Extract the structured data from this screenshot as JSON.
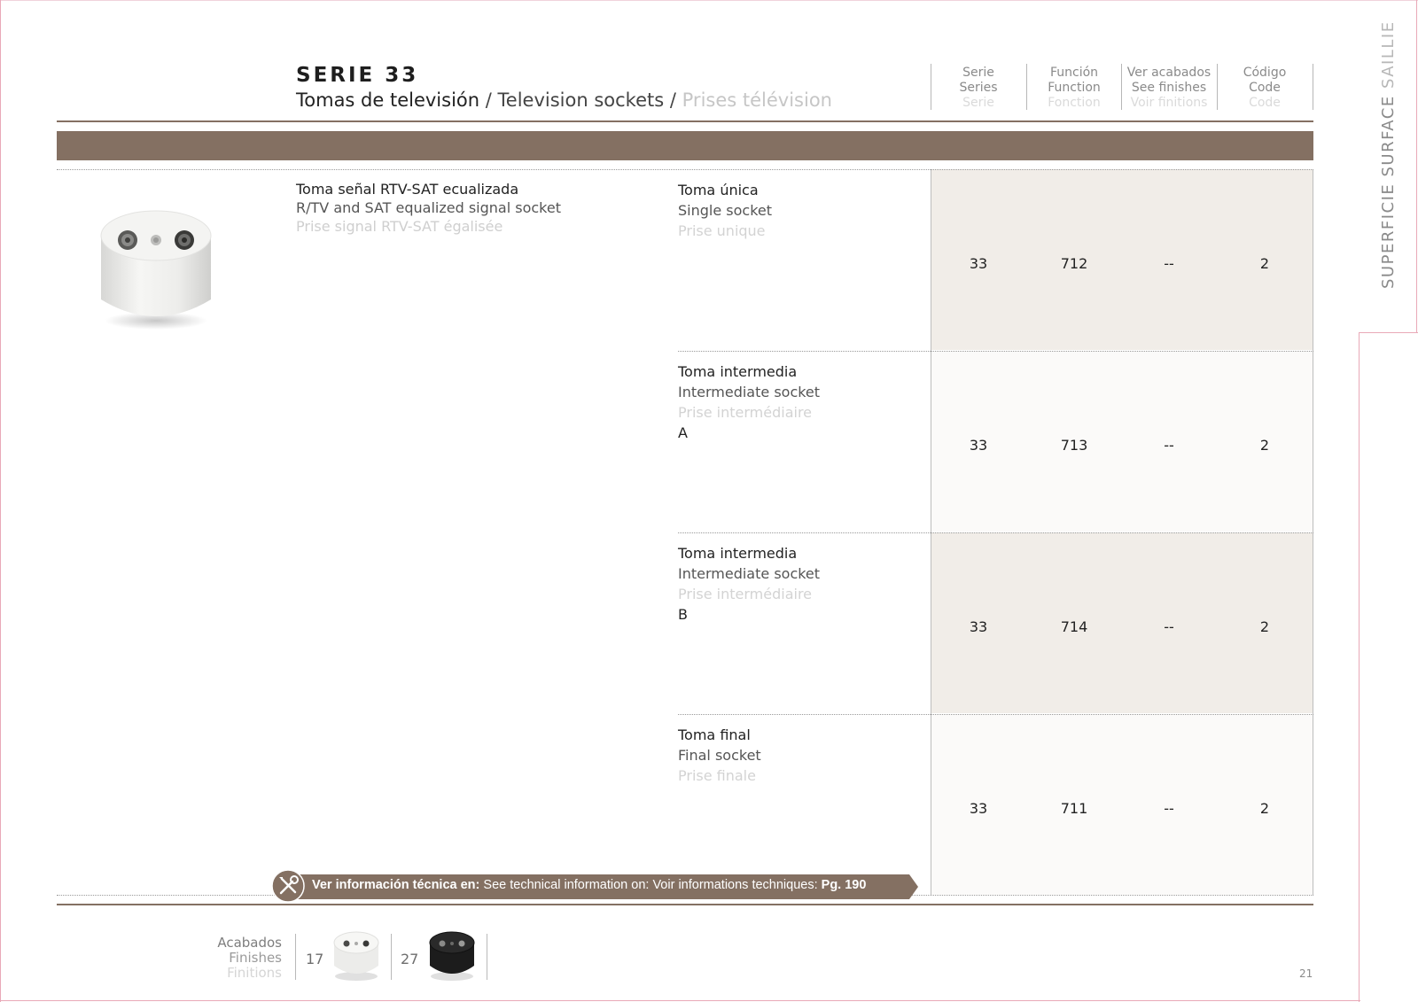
{
  "header": {
    "series_title": "SERIE 33",
    "subtitle_es": "Tomas de televisión",
    "separator": "/",
    "subtitle_en": "Television sockets",
    "subtitle_fr": "Prises télévision"
  },
  "columns": [
    {
      "es": "Serie",
      "en": "Series",
      "fr": "Serie"
    },
    {
      "es": "Función",
      "en": "Function",
      "fr": "Fonction"
    },
    {
      "es": "Ver acabados",
      "en": "See finishes",
      "fr": "Voir finitions"
    },
    {
      "es": "Código",
      "en": "Code",
      "fr": "Code"
    }
  ],
  "product": {
    "name_es": "Toma señal RTV-SAT ecualizada",
    "name_en": "R/TV and SAT equalized signal socket",
    "name_fr": "Prise signal RTV-SAT égalisée"
  },
  "rows": [
    {
      "es": "Toma única",
      "en": "Single socket",
      "fr": "Prise unique",
      "letter": "",
      "serie": "33",
      "funcion": "712",
      "acabados": "--",
      "codigo": "2"
    },
    {
      "es": "Toma intermedia",
      "en": "Intermediate socket",
      "fr": "Prise intermédiaire",
      "letter": "A",
      "serie": "33",
      "funcion": "713",
      "acabados": "--",
      "codigo": "2"
    },
    {
      "es": "Toma intermedia",
      "en": "Intermediate socket",
      "fr": "Prise intermédiaire",
      "letter": "B",
      "serie": "33",
      "funcion": "714",
      "acabados": "--",
      "codigo": "2"
    },
    {
      "es": "Toma final",
      "en": "Final socket",
      "fr": "Prise finale",
      "letter": "",
      "serie": "33",
      "funcion": "711",
      "acabados": "--",
      "codigo": "2"
    }
  ],
  "technical_info": {
    "es": "Ver información técnica en:",
    "en": "See technical information on:",
    "fr": "Voir informations techniques:",
    "page": "Pg. 190"
  },
  "finishes": {
    "label_es": "Acabados",
    "label_en": "Finishes",
    "label_fr": "Finitions",
    "items": [
      {
        "code": "17",
        "color": "white"
      },
      {
        "code": "27",
        "color": "black"
      }
    ]
  },
  "side_tab": {
    "es": "SUPERFICIE",
    "en": "SURFACE",
    "fr": "SAILLIE"
  },
  "page_number": "21",
  "colors": {
    "accent_brown": "#847062",
    "row_shaded": "#f1ede8"
  }
}
